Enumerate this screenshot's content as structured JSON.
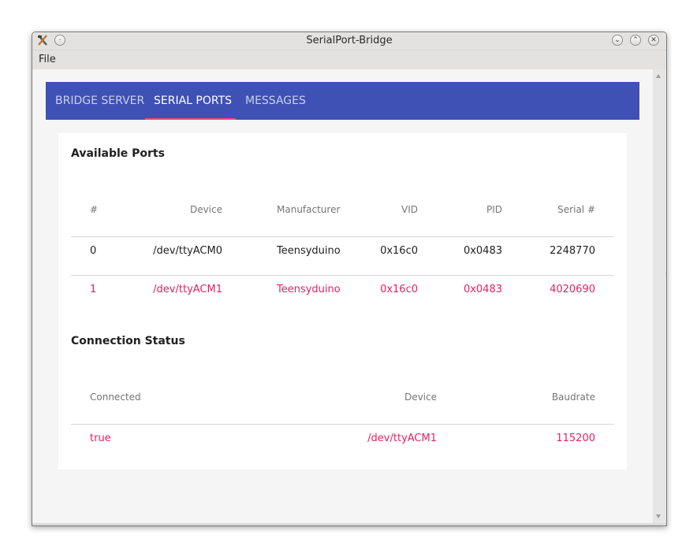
{
  "window": {
    "title": "SerialPort-Bridge"
  },
  "menu": {
    "file": "File"
  },
  "tabs": [
    {
      "label": "BRIDGE SERVER"
    },
    {
      "label": "SERIAL PORTS"
    },
    {
      "label": "MESSAGES"
    }
  ],
  "available_ports": {
    "title": "Available Ports",
    "headers": [
      "#",
      "Device",
      "Manufacturer",
      "VID",
      "PID",
      "Serial #"
    ],
    "rows": [
      [
        "0",
        "/dev/ttyACM0",
        "Teensyduino",
        "0x16c0",
        "0x0483",
        "2248770"
      ],
      [
        "1",
        "/dev/ttyACM1",
        "Teensyduino",
        "0x16c0",
        "0x0483",
        "4020690"
      ]
    ]
  },
  "connection_status": {
    "title": "Connection Status",
    "headers": [
      "Connected",
      "Device",
      "Baudrate"
    ],
    "rows": [
      [
        "true",
        "/dev/ttyACM1",
        "115200"
      ]
    ]
  },
  "colors": {
    "primary": "#3f51b5",
    "accent": "#e91e63",
    "indicator": "#ff4081"
  }
}
